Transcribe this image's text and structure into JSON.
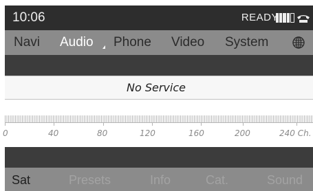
{
  "status": {
    "time": "10:06",
    "ready_text": "READY",
    "signal_icon": "signal-strength-bars",
    "phone_icon": "phone-handset"
  },
  "menu": {
    "items": [
      {
        "label": "Navi",
        "active": false
      },
      {
        "label": "Audio",
        "active": true
      },
      {
        "label": "Phone",
        "active": false
      },
      {
        "label": "Video",
        "active": false
      },
      {
        "label": "System",
        "active": false
      }
    ],
    "globe_icon": "globe"
  },
  "station": {
    "name": "No Service"
  },
  "scale": {
    "labels": [
      "0",
      "40",
      "80",
      "120",
      "160",
      "200",
      "240 Ch."
    ]
  },
  "softkeys": {
    "items": [
      {
        "label": "Sat",
        "active": true
      },
      {
        "label": "Presets",
        "active": false
      },
      {
        "label": "Info",
        "active": false
      },
      {
        "label": "Cat.",
        "active": false
      },
      {
        "label": "Sound",
        "active": false
      }
    ]
  },
  "colors": {
    "status_bar": "#2d2d2d",
    "menu_bar": "#8b8b8b",
    "dark_band": "#3c3c3c",
    "active_text": "#ffffff",
    "inactive_softkey": "#a3a3a3"
  }
}
